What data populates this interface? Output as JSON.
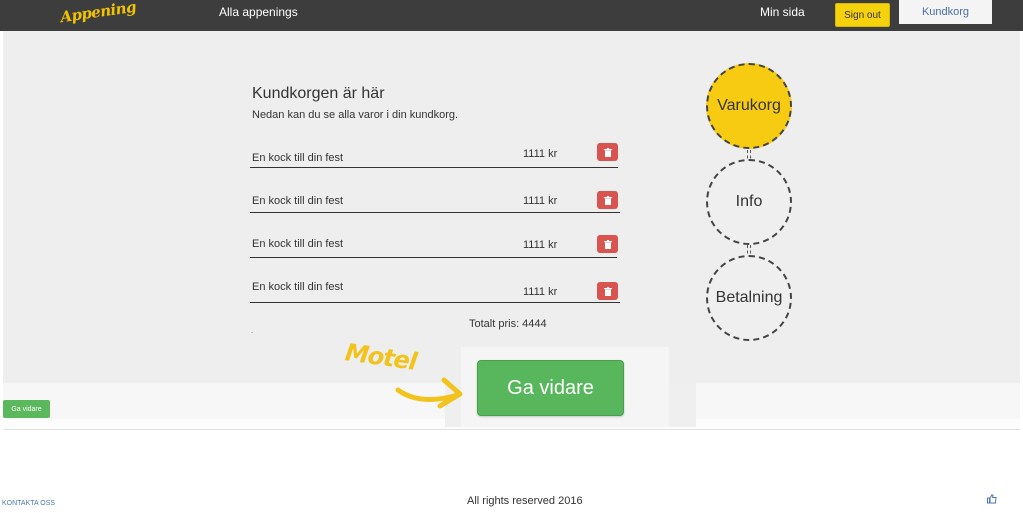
{
  "navbar": {
    "logo_text": "Appening",
    "all_link": "Alla appenings",
    "my_page_link": "Min sida",
    "signout_label": "Sign out",
    "cart_label": "Kundkorg"
  },
  "cart": {
    "title": "Kundkorgen är här",
    "subtitle": "Nedan kan du se alla varor i din kundkorg.",
    "items": [
      {
        "name": "En kock till din fest",
        "price": "1111 kr"
      },
      {
        "name": "En kock till din fest",
        "price": "1111 kr"
      },
      {
        "name": "En kock till din fest",
        "price": "1111 kr"
      },
      {
        "name": "En kock till din fest",
        "price": "1111 kr"
      }
    ],
    "total": "Totalt pris: 4444",
    "dot": "."
  },
  "steps": [
    {
      "label": "Varukorg",
      "active": true
    },
    {
      "label": "Info",
      "active": false
    },
    {
      "label": "Betalning",
      "active": false
    }
  ],
  "actions": {
    "big_continue": "Ga vidare",
    "small_continue": "Ga vidare"
  },
  "annotation": {
    "text": "Motel",
    "color": "#f2c31c"
  },
  "footer": {
    "contact": "KONTAKTA OSS",
    "rights": "All rights reserved 2016",
    "icon": "thumbs-up-icon"
  },
  "colors": {
    "navbar": "#3d3d3d",
    "accent_yellow": "#f8cb13",
    "delete_red": "#d9534f",
    "continue_green": "#58b75c"
  }
}
